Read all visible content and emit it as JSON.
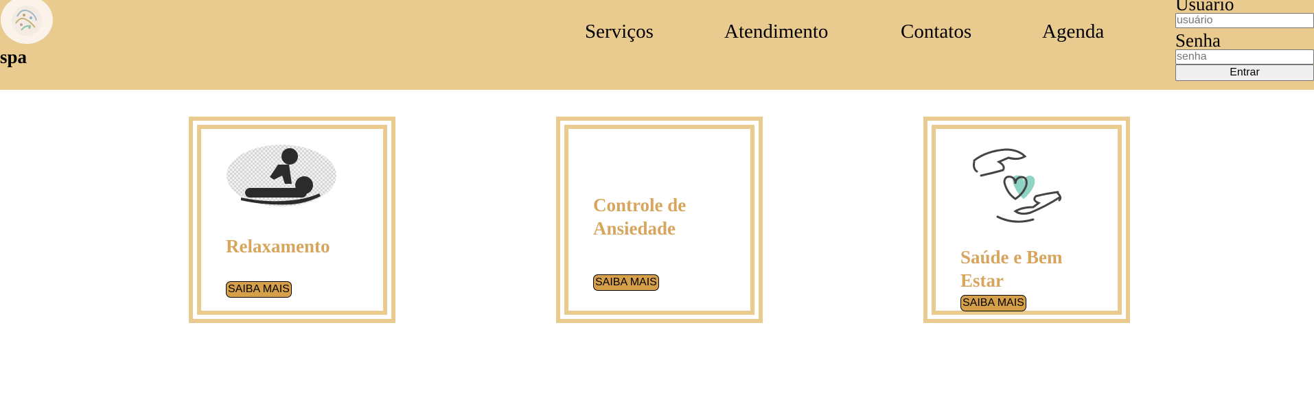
{
  "header": {
    "brand": "spa",
    "nav": [
      "Serviços",
      "Atendimento",
      "Contatos",
      "Agenda"
    ]
  },
  "login": {
    "user_label": "Usuário",
    "user_placeholder": "usuário",
    "pass_label": "Senha",
    "pass_placeholder": "senha",
    "submit_label": "Entrar"
  },
  "cards": [
    {
      "title": "Relaxamento",
      "button": "SAIBA MAIS",
      "icon": "massage-icon"
    },
    {
      "title": "Controle de Ansiedade",
      "button": "SAIBA MAIS",
      "icon": ""
    },
    {
      "title": "Saúde e Bem Estar",
      "button": "SAIBA MAIS",
      "icon": "heart-hands-icon"
    }
  ],
  "colors": {
    "header_bg": "#e9cb90",
    "card_border": "#e9cb90",
    "title_text": "#d6a65e",
    "button_bg": "#d6a04b",
    "heart": "#8fd3c4"
  }
}
